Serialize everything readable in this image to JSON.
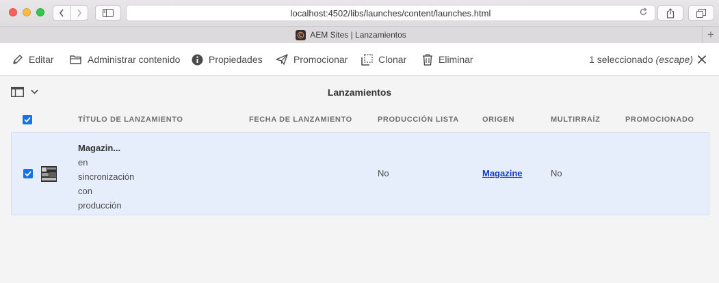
{
  "browser": {
    "url": "localhost:4502/libs/launches/content/launches.html",
    "tab_title": "AEM Sites | Lanzamientos",
    "new_tab_label": "+"
  },
  "actionbar": {
    "edit": "Editar",
    "manage_content": "Administrar contenido",
    "properties": "Propiedades",
    "promote": "Promocionar",
    "clone": "Clonar",
    "delete": "Eliminar",
    "selection_count": "1 seleccionado",
    "escape_hint": "(escape)"
  },
  "titlebar": {
    "title": "Lanzamientos"
  },
  "table": {
    "columns": [
      "Título de lanzamiento",
      "Fecha de lanzamiento",
      "Producción lista",
      "Origen",
      "Multirraíz",
      "Promocionado"
    ],
    "rows": [
      {
        "title": "Magazin...",
        "status": "en sincronización con producción",
        "status_lines": [
          "en",
          "sincronización",
          "con",
          "producción"
        ],
        "launch_date": "",
        "production_ready": "No",
        "source": "Magazine",
        "multiroot": "No",
        "promoted": "",
        "selected": true
      }
    ]
  },
  "colors": {
    "accent": "#1473e6",
    "selected_row": "#e6eefb",
    "link": "#0e3cc4"
  }
}
